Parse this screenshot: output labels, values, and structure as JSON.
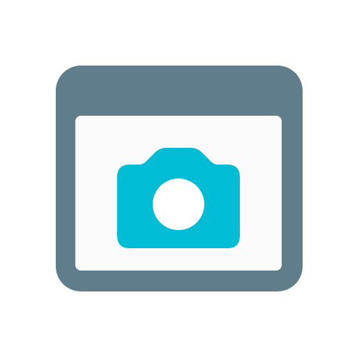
{
  "icon": {
    "name": "screenshot-app-icon",
    "frame_icon": "browser-window-icon",
    "content_icon": "camera-icon",
    "colors": {
      "frame": "#607D8B",
      "content_bg": "#FAFAFA",
      "camera_body": "#00BCD4",
      "camera_lens": "#FFFFFF",
      "page_bg": "#FFFFFF"
    }
  }
}
